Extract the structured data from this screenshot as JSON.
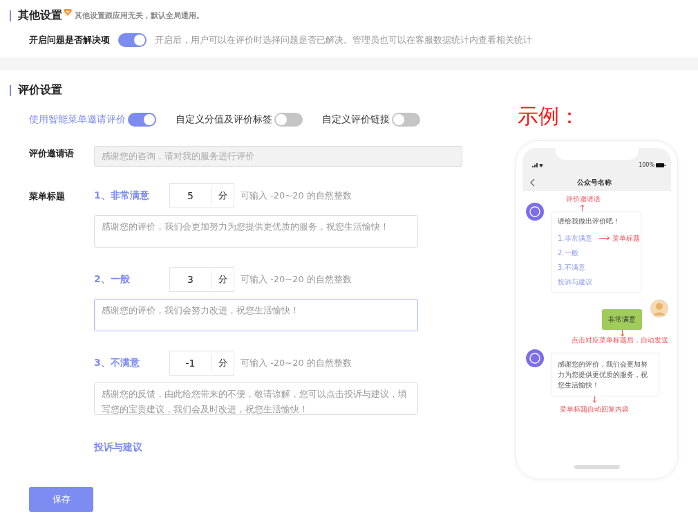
{
  "other_settings": {
    "title": "其他设置",
    "subtitle": "其他设置跟应用无关，默认全局通用。",
    "option": {
      "label": "开启问题是否解决项",
      "on": true,
      "description": "开启后，用户可以在评价时选择问题是否已解决。管理员也可以在客服数据统计内查看相关统计"
    }
  },
  "rating_settings": {
    "title": "评价设置",
    "toggles": [
      {
        "label": "使用智能菜单邀请评价",
        "on": true
      },
      {
        "label": "自定义分值及评价标签",
        "on": false
      },
      {
        "label": "自定义评价链接",
        "on": false
      }
    ],
    "invitation": {
      "label": "评价邀请语",
      "value": "感谢您的咨询，请对我的服务进行评价",
      "disabled": true
    },
    "menu_label": "菜单标题",
    "menu_items": [
      {
        "title": "1、非常满意",
        "score": "5",
        "unit": "分",
        "hint": "可输入 -20~20 的自然整数",
        "reply": "感谢您的评价，我们会更加努力为您提供更优质的服务，祝您生活愉快！",
        "focused": false
      },
      {
        "title": "2、一般",
        "score": "3",
        "unit": "分",
        "hint": "可输入 -20~20 的自然整数",
        "reply": "感谢您的评价，我们会努力改进，祝您生活愉快！",
        "focused": true
      },
      {
        "title": "3、不满意",
        "score": "-1",
        "unit": "分",
        "hint": "可输入 -20~20 的自然整数",
        "reply": "感谢您的反馈，由此给您带来的不便，敬请谅解，您可以点击投诉与建议，填写您的宝贵建议，我们会及时改进，祝您生活愉快！",
        "focused": false
      }
    ],
    "complaint_link": "投诉与建议",
    "save_button": "保存"
  },
  "example": {
    "title": "示例：",
    "phone": {
      "battery": "100%",
      "account_name": "公众号名称",
      "invite_note": "评价邀请语",
      "invite_text": "请给我做出评价吧！",
      "menu_options": [
        "1.非常满意",
        "2.一般",
        "3.不满意",
        "投诉与建议"
      ],
      "menu_note": "菜单标题",
      "user_reply": "非常满意",
      "send_note": "点击对应菜单标题后，自动发送",
      "auto_reply": "感谢您的评价，我们会更加努力为您提供更优质的服务，祝您生活愉快！",
      "reply_note": "菜单标题自动回复内容"
    }
  }
}
